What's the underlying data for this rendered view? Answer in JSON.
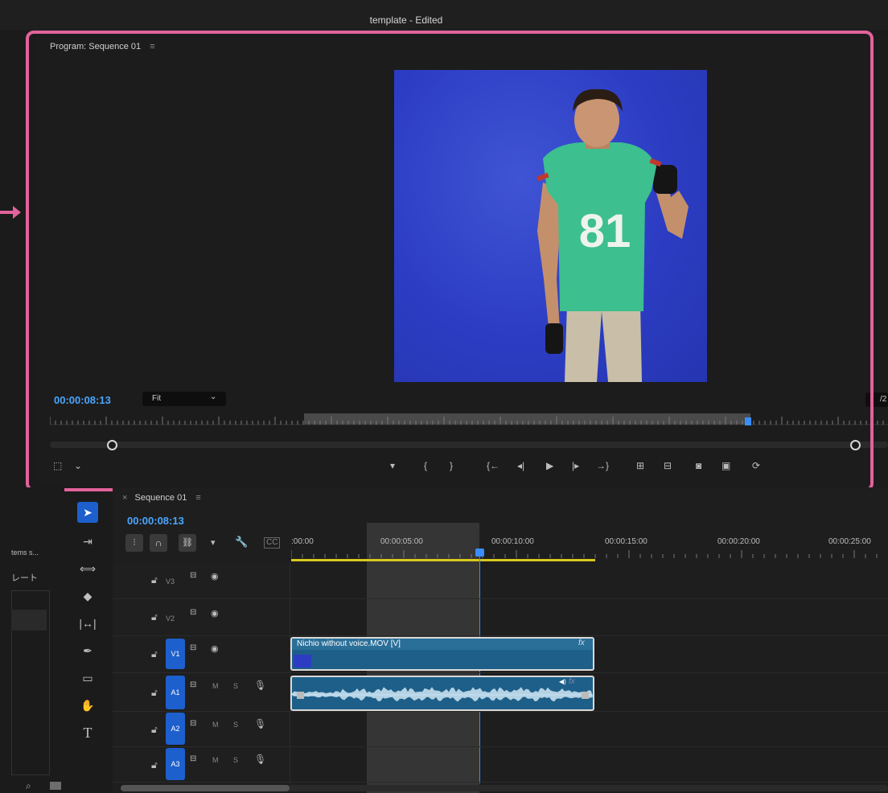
{
  "window": {
    "title": "template - Edited"
  },
  "program_monitor": {
    "panel_title": "Program: Sequence 01",
    "timecode": "00:00:08:13",
    "zoom": "Fit",
    "page_indicator": "/2",
    "jersey_number": "81"
  },
  "transport": {
    "buttons": [
      "add-marker",
      "mark-in",
      "mark-out",
      "go-to-in",
      "step-back",
      "play",
      "step-forward",
      "go-to-out",
      "lift",
      "extract",
      "export-frame",
      "comparison-view",
      "settings"
    ]
  },
  "left_panel": {
    "item1": "tems s...",
    "item2": "レート"
  },
  "timeline": {
    "tab_title": "Sequence 01",
    "timecode": "00:00:08:13",
    "ruler_labels": [
      ":00:00",
      "00:00:05:00",
      "00:00:10:00",
      "00:00:15:00",
      "00:00:20:00",
      "00:00:25:00"
    ],
    "tracks": [
      {
        "name": "V3",
        "type": "video"
      },
      {
        "name": "V2",
        "type": "video"
      },
      {
        "name": "V1",
        "type": "video",
        "selected": true
      },
      {
        "name": "A1",
        "type": "audio",
        "selected": true
      },
      {
        "name": "A2",
        "type": "audio",
        "selected": true
      },
      {
        "name": "A3",
        "type": "audio",
        "selected": true
      }
    ],
    "video_clip": {
      "name": "Nichio without voice.MOV [V]",
      "fx": "fx"
    },
    "audio_clip": {
      "fx": "fx"
    },
    "mute_label": "M",
    "solo_label": "S"
  },
  "colors": {
    "accent": "#1d5fcd",
    "timecode": "#4aa6ff",
    "highlight": "#e2629b",
    "clip": "#1d5f88",
    "background": "#1b1b1b"
  }
}
